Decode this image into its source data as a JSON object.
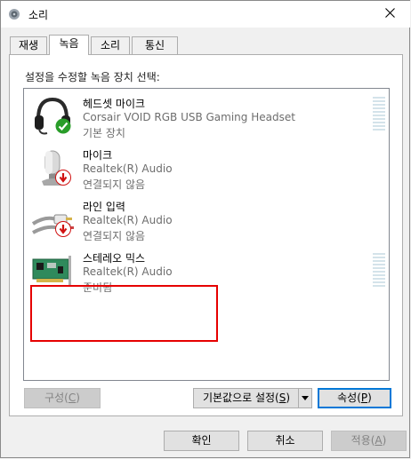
{
  "window": {
    "title": "소리",
    "close_glyph": "✕"
  },
  "tabs": [
    {
      "label": "재생"
    },
    {
      "label": "녹음"
    },
    {
      "label": "소리"
    },
    {
      "label": "통신"
    }
  ],
  "active_tab": "녹음",
  "instruction": "설정을 수정할 녹음 장치 선택:",
  "devices": [
    {
      "name": "헤드셋 마이크",
      "sub": "Corsair VOID RGB USB Gaming Headset",
      "status": "기본 장치",
      "icon": "headset-icon",
      "badge": "check-icon",
      "badge_color": "#2a9d2a"
    },
    {
      "name": "마이크",
      "sub": "Realtek(R) Audio",
      "status": "연결되지 않음",
      "icon": "microphone-icon",
      "badge": "down-arrow-icon",
      "badge_color": "#d01010"
    },
    {
      "name": "라인 입력",
      "sub": "Realtek(R) Audio",
      "status": "연결되지 않음",
      "icon": "line-in-cable-icon",
      "badge": "down-arrow-icon",
      "badge_color": "#d01010"
    },
    {
      "name": "스테레오 믹스",
      "sub": "Realtek(R) Audio",
      "status": "준비됨",
      "icon": "sound-card-icon",
      "badge": "",
      "badge_color": ""
    }
  ],
  "buttons": {
    "configure": {
      "label": "구성(",
      "mnemonic": "C",
      "suffix": ")"
    },
    "set_default": {
      "label": "기본값으로 설정(",
      "mnemonic": "S",
      "suffix": ")"
    },
    "properties": {
      "label": "속성(",
      "mnemonic": "P",
      "suffix": ")"
    },
    "ok": "확인",
    "cancel": "취소",
    "apply": {
      "label": "적용(",
      "mnemonic": "A",
      "suffix": ")"
    }
  },
  "colors": {
    "highlight": "#e60000",
    "focus": "#0078d7",
    "meter": "#d4e3ea"
  }
}
